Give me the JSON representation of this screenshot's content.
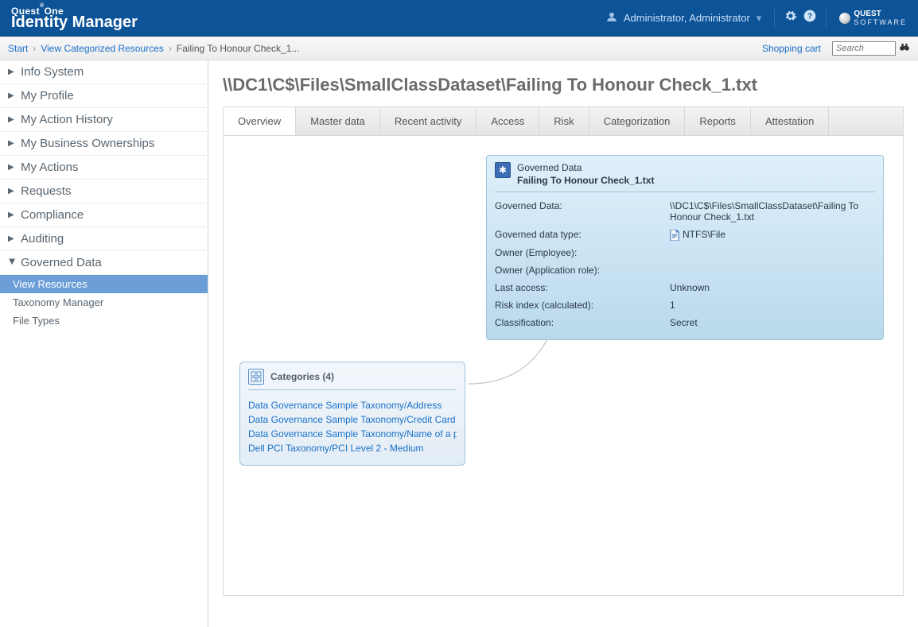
{
  "header": {
    "logo_small": "Quest",
    "logo_small_sup": "®",
    "logo_small_tail": "One",
    "logo_big_bold": "Identity",
    "logo_big_rest": " Manager",
    "user_name": "Administrator, Administrator",
    "brand_top": "QUEST",
    "brand_bottom": "SOFTWARE"
  },
  "breadcrumb": {
    "start": "Start",
    "level1": "View Categorized Resources",
    "current": "Failing To Honour Check_1...",
    "cart": "Shopping cart",
    "search_placeholder": "Search"
  },
  "sidebar": {
    "items": [
      "Info System",
      "My Profile",
      "My Action History",
      "My Business Ownerships",
      "My Actions",
      "Requests",
      "Compliance",
      "Auditing",
      "Governed Data"
    ],
    "sub": [
      "View Resources",
      "Taxonomy Manager",
      "File Types"
    ]
  },
  "page": {
    "title": "\\\\DC1\\C$\\Files\\SmallClassDataset\\Failing To Honour Check_1.txt"
  },
  "tabs": [
    "Overview",
    "Master data",
    "Recent activity",
    "Access",
    "Risk",
    "Categorization",
    "Reports",
    "Attestation"
  ],
  "info_card": {
    "header_small": "Governed Data",
    "header_bold": "Failing To Honour Check_1.txt",
    "rows": {
      "governed_data_label": "Governed Data:",
      "governed_data_value": "\\\\DC1\\C$\\Files\\SmallClassDataset\\Failing To Honour Check_1.txt",
      "type_label": "Governed data type:",
      "type_value": "NTFS\\File",
      "owner_emp_label": "Owner (Employee):",
      "owner_emp_value": "",
      "owner_role_label": "Owner (Application role):",
      "owner_role_value": "",
      "last_access_label": "Last access:",
      "last_access_value": "Unknown",
      "risk_label": "Risk index (calculated):",
      "risk_value": "1",
      "class_label": "Classification:",
      "class_value": "Secret"
    }
  },
  "categories": {
    "title": "Categories (4)",
    "items": [
      "Data Governance Sample Taxonomy/Address",
      "Data Governance Sample Taxonomy/Credit Card I",
      "Data Governance Sample Taxonomy/Name of a pe",
      "Dell PCI Taxonomy/PCI Level 2 - Medium"
    ]
  }
}
